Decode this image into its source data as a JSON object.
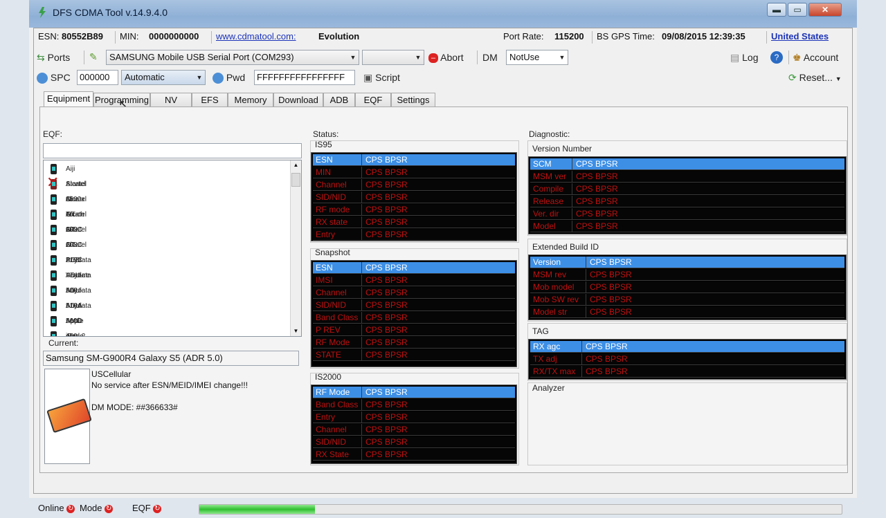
{
  "window": {
    "title": "DFS CDMA Tool v.14.9.4.0",
    "min": "▬",
    "max": "▭",
    "close": "✕"
  },
  "info": {
    "esn_label": "ESN:",
    "esn": "80552B89",
    "min_label": "MIN:",
    "min": "0000000000",
    "url": "www.cdmatool.com:",
    "edition": "Evolution",
    "port_rate_label": "Port Rate:",
    "port_rate": "115200",
    "bs_gps_label": "BS GPS Time:",
    "bs_gps": "09/08/2015 12:39:35",
    "country": "United States"
  },
  "toolbar1": {
    "ports": "Ports",
    "port_select": "SAMSUNG Mobile USB Serial Port (COM293)",
    "extra_select": "",
    "abort": "Abort",
    "dm_label": "DM",
    "dm_select": "NotUse",
    "log": "Log",
    "help": "?",
    "account": "Account"
  },
  "toolbar2": {
    "spc": "SPC",
    "spc_value": "000000",
    "spc_mode": "Automatic",
    "pwd": "Pwd",
    "pwd_value": "FFFFFFFFFFFFFFFF",
    "script": "Script",
    "reset": "Reset..."
  },
  "tabs": [
    "Equipment",
    "Programming",
    "NV",
    "EFS",
    "Memory",
    "Download",
    "ADB",
    "EQF",
    "Settings"
  ],
  "eqf": {
    "label": "EQF:",
    "search": "",
    "items": [
      {
        "name": "Aiji Startel 8500x",
        "icon": "phone-icon"
      },
      {
        "name": "Alcatel One Touch 990C",
        "icon": "phone-error-icon"
      },
      {
        "name": "Alcatel OT-203C",
        "icon": "phone-icon"
      },
      {
        "name": "Alcatel OT-208C",
        "icon": "phone-icon"
      },
      {
        "name": "Alcatel OT-219C",
        "icon": "phone-icon"
      },
      {
        "name": "Alcatel PCD Venture",
        "icon": "phone-icon"
      },
      {
        "name": "Anydata ADU-500",
        "icon": "phone-icon"
      },
      {
        "name": "Anydata ADU-510A",
        "icon": "phone-icon"
      },
      {
        "name": "Anydata ADU-560D",
        "icon": "phone-icon"
      },
      {
        "name": "Anydata AMC-450",
        "icon": "phone-icon"
      },
      {
        "name": "Apple iPad 2 CDMA (OTA only)",
        "icon": "phone-icon"
      },
      {
        "name": "Apple iPhone 4 CDMA (OTA only)",
        "icon": "phone-icon"
      }
    ],
    "current_label": "Current:",
    "current": "Samsung SM-G900R4 Galaxy S5 (ADR 5.0)",
    "notes": [
      "USCellular",
      "No service after ESN/MEID/IMEI change!!!",
      "",
      "DM MODE: ##366633#"
    ]
  },
  "status": {
    "label": "Status:",
    "is95": {
      "title": "IS95",
      "header": [
        "ESN",
        "CPS  BPSR"
      ],
      "rows": [
        "MIN",
        "Channel",
        "SID/NID",
        "RF mode",
        "RX state",
        "Entry"
      ],
      "value": "CPS  BPSR"
    },
    "snapshot": {
      "title": "Snapshot",
      "header": [
        "ESN",
        "CPS  BPSR"
      ],
      "rows": [
        "IMSI",
        "Channel",
        "SID/NID",
        "Band Class",
        "P REV",
        "RF Mode",
        "STATE"
      ],
      "value": "CPS  BPSR"
    },
    "is2000": {
      "title": "IS2000",
      "header": [
        "RF Mode",
        "CPS  BPSR"
      ],
      "rows": [
        "Band Class",
        "Entry",
        "Channel",
        "SID/NID",
        "RX State"
      ],
      "value": "CPS  BPSR"
    }
  },
  "diagnostic": {
    "label": "Diagnostic:",
    "version": {
      "title": "Version Number",
      "header": [
        "SCM",
        "CPS  BPSR"
      ],
      "rows": [
        "MSM ver",
        "Compile",
        "Release",
        "Ver. dir",
        "Model"
      ],
      "value": "CPS  BPSR"
    },
    "build": {
      "title": "Extended Build ID",
      "header": [
        "Version",
        "CPS  BPSR"
      ],
      "rows": [
        "MSM rev",
        "Mob model",
        "Mob SW rev",
        "Model str"
      ],
      "value": "CPS  BPSR"
    },
    "tag": {
      "title": "TAG",
      "header": [
        "RX agc",
        "CPS  BPSR"
      ],
      "rows": [
        "TX adj",
        "RX/TX max"
      ],
      "value": "CPS  BPSR"
    },
    "analyzer": "Analyzer"
  },
  "statusbar": {
    "online": "Online",
    "mode": "Mode",
    "eqf": "EQF",
    "progress": 0.18
  }
}
